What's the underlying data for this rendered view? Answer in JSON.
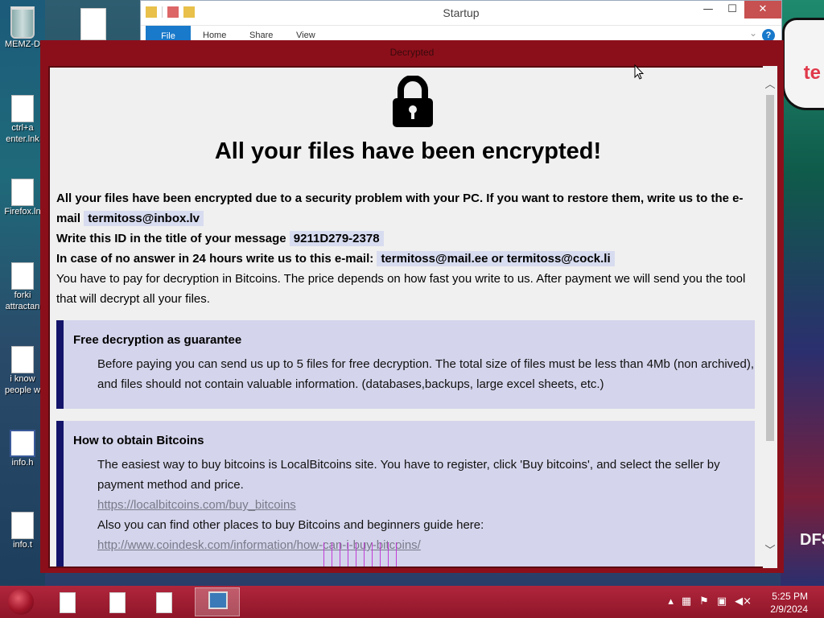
{
  "desktop": {
    "icons": [
      {
        "label": "MEMZ-D",
        "icon": "recycle-bin-icon"
      },
      {
        "label": "ctrl+a\nenter.lnk",
        "icon": "file-icon"
      },
      {
        "label": "Firefox.ln",
        "icon": "file-icon"
      },
      {
        "label": "forki\nattractan",
        "icon": "file-icon"
      },
      {
        "label": "i know\npeople w",
        "icon": "file-icon"
      },
      {
        "label": "info.h",
        "icon": "window-icon"
      },
      {
        "label": "info.t",
        "icon": "text-file-icon"
      }
    ],
    "sign_text": "te",
    "sign_bottom_text": "DFS"
  },
  "explorer": {
    "title": "Startup",
    "tabs": [
      "File",
      "Home",
      "Share",
      "View"
    ],
    "controls": {
      "minimize": "—",
      "maximize": "☐",
      "close": "✕"
    },
    "help": "?"
  },
  "ransom": {
    "window_title": "Decrypted",
    "headline": "All your files have been encrypted!",
    "line1_prefix": "All your files have been encrypted due to a security problem with your PC. If you want to restore them, write us to the e-mail",
    "email1": "termitoss@inbox.lv",
    "line2_prefix": "Write this ID in the title of your message",
    "id": "9211D279-2378",
    "line3_prefix": "In case of no answer in 24 hours write us to this e-mail:",
    "email2": "termitoss@mail.ee or termitoss@cock.li",
    "line4": "You have to pay for decryption in Bitcoins. The price depends on how fast you write to us. After payment we will send you the tool that will decrypt all your files.",
    "box1": {
      "title": "Free decryption as guarantee",
      "text": "Before paying you can send us up to 5 files for free decryption. The total size of files must be less than 4Mb (non archived), and files should not contain valuable information. (databases,backups, large excel sheets, etc.)"
    },
    "box2": {
      "title": "How to obtain Bitcoins",
      "text": "The easiest way to buy bitcoins is LocalBitcoins site. You have to register, click 'Buy bitcoins', and select the seller by payment method and price.",
      "link1": "https://localbitcoins.com/buy_bitcoins",
      "text2": "Also you can find other places to buy Bitcoins and beginners guide here:",
      "link2": "http://www.coindesk.com/information/how-can-i-buy-bitcoins/"
    }
  },
  "taskbar": {
    "tray_icons": [
      "up-arrow-icon",
      "network-icon",
      "flag-icon",
      "display-icon",
      "volume-muted-icon"
    ],
    "time": "5:25 PM",
    "date": "2/9/2024"
  }
}
